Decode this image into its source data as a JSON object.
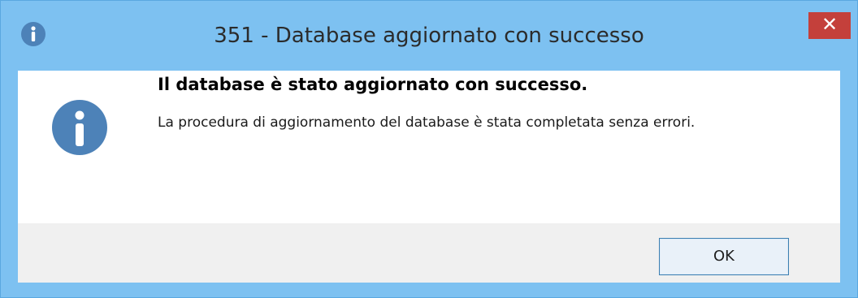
{
  "window": {
    "title": "351 - Database aggiornato con successo",
    "close_label": "✕",
    "frame_color": "#7dc1f1",
    "close_color": "#c4403b"
  },
  "title_icon": "info-icon",
  "message": {
    "icon": "info-icon",
    "main_instruction": "Il database è stato aggiornato con successo.",
    "content": "La procedura di aggiornamento del database è stata completata senza errori.",
    "icon_color": "#4d82b8"
  },
  "footer": {
    "ok_label": "OK"
  }
}
